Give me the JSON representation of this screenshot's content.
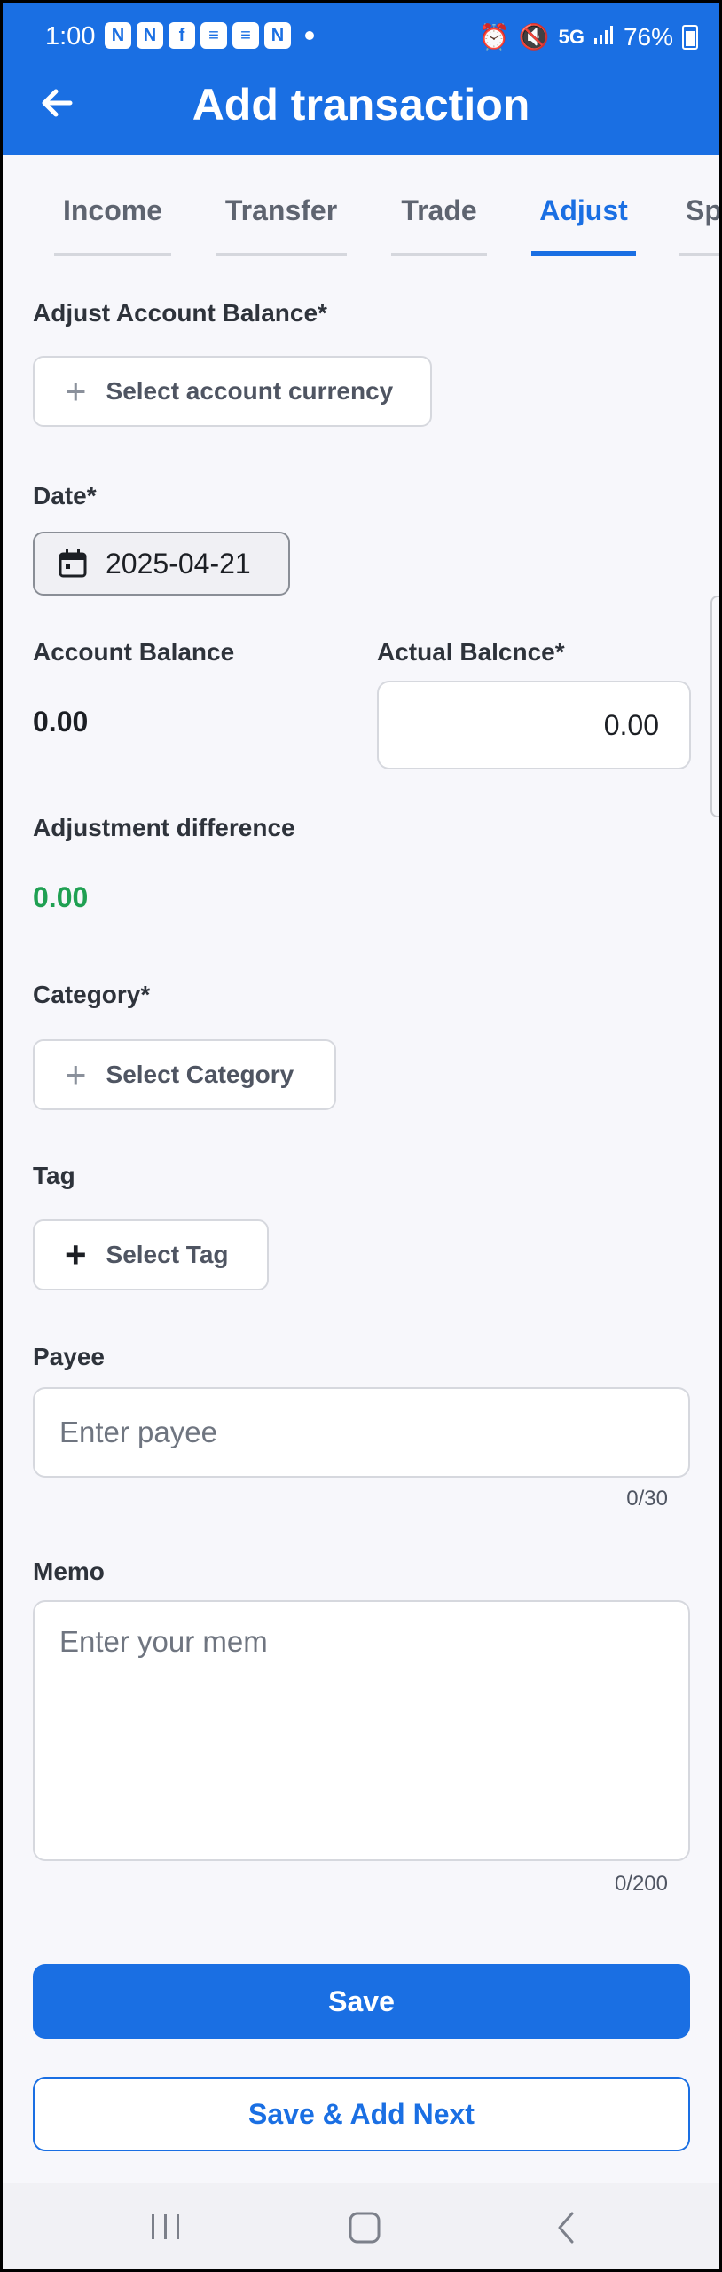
{
  "status_bar": {
    "time": "1:00",
    "network": "5G",
    "battery": "76%"
  },
  "header": {
    "title": "Add transaction",
    "back_icon": "arrow-left-icon"
  },
  "tabs": [
    {
      "label": "Income",
      "active": false
    },
    {
      "label": "Transfer",
      "active": false
    },
    {
      "label": "Trade",
      "active": false
    },
    {
      "label": "Adjust",
      "active": true
    },
    {
      "label": "Sp",
      "active": false
    }
  ],
  "form": {
    "adjust_label": "Adjust Account Balance*",
    "account_currency_button": "Select account currency",
    "date_label": "Date*",
    "date_value": "2025-04-21",
    "account_balance_label": "Account Balance",
    "account_balance_value": "0.00",
    "actual_balance_label": "Actual Balcnce*",
    "actual_balance_value": "0.00",
    "adjustment_label": "Adjustment difference",
    "adjustment_value": "0.00",
    "category_label": "Category*",
    "category_button": "Select Category",
    "tag_label": "Tag",
    "tag_button": "Select Tag",
    "payee_label": "Payee",
    "payee_placeholder": "Enter payee",
    "payee_counter": "0/30",
    "memo_label": "Memo",
    "memo_placeholder": "Enter your mem",
    "memo_counter": "0/200"
  },
  "actions": {
    "save": "Save",
    "save_next": "Save & Add Next"
  },
  "colors": {
    "primary": "#1a6fe3",
    "positive": "#1fa052"
  }
}
